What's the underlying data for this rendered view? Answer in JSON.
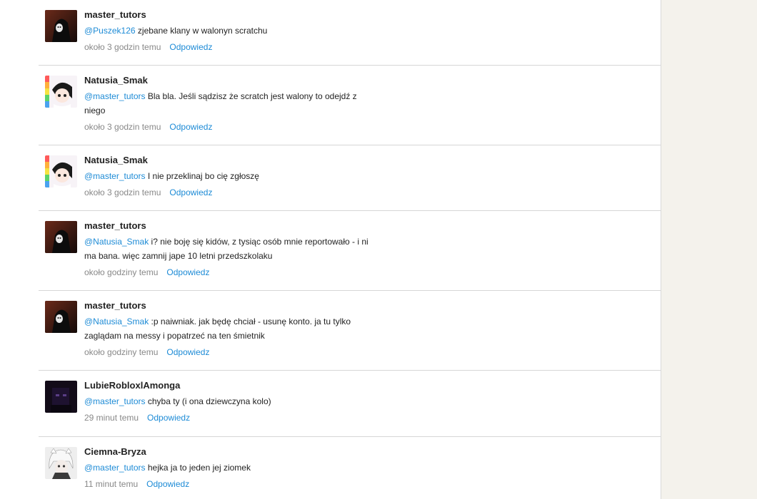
{
  "comments": [
    {
      "username": "master_tutors",
      "mention": "@Puszek126",
      "text": " zjebane klany w walonyn scratchu",
      "time": "około 3 godzin temu",
      "reply": "Odpowiedz",
      "avatar": "dark-hooded-avatar"
    },
    {
      "username": "Natusia_Smak",
      "mention": "@master_tutors",
      "text": " Bla bla. Jeśli sądzisz że scratch jest walony to odejdź z niego",
      "time": "około 3 godzin temu",
      "reply": "Odpowiedz",
      "avatar": "anime-girl-rainbow-avatar"
    },
    {
      "username": "Natusia_Smak",
      "mention": "@master_tutors",
      "text": " I nie przeklinaj bo cię zgłoszę",
      "time": "około 3 godzin temu",
      "reply": "Odpowiedz",
      "avatar": "anime-girl-rainbow-avatar"
    },
    {
      "username": "master_tutors",
      "mention": "@Natusia_Smak",
      "text": " i? nie boję się kidów, z tysiąc osób mnie reportowało - i ni ma bana. więc zamnij jape 10 letni przedszkolaku",
      "time": "około godziny temu",
      "reply": "Odpowiedz",
      "avatar": "dark-hooded-avatar"
    },
    {
      "username": "master_tutors",
      "mention": "@Natusia_Smak",
      "text": " :p naiwniak. jak będę chciał - usunę konto. ja tu tylko zaglądam na messy i popatrzeć na ten śmietnik",
      "time": "około godziny temu",
      "reply": "Odpowiedz",
      "avatar": "dark-hooded-avatar"
    },
    {
      "username": "LubieRobloxlAmonga",
      "mention": "@master_tutors",
      "text": " chyba ty (i ona dziewczyna kolo)",
      "time": "29 minut temu",
      "reply": "Odpowiedz",
      "avatar": "dark-purple-avatar"
    },
    {
      "username": "Ciemna-Bryza",
      "mention": "@master_tutors",
      "text": " hejka ja to jeden jej ziomek",
      "time": "11 minut temu",
      "reply": "Odpowiedz",
      "avatar": "white-haired-anime-avatar"
    }
  ]
}
